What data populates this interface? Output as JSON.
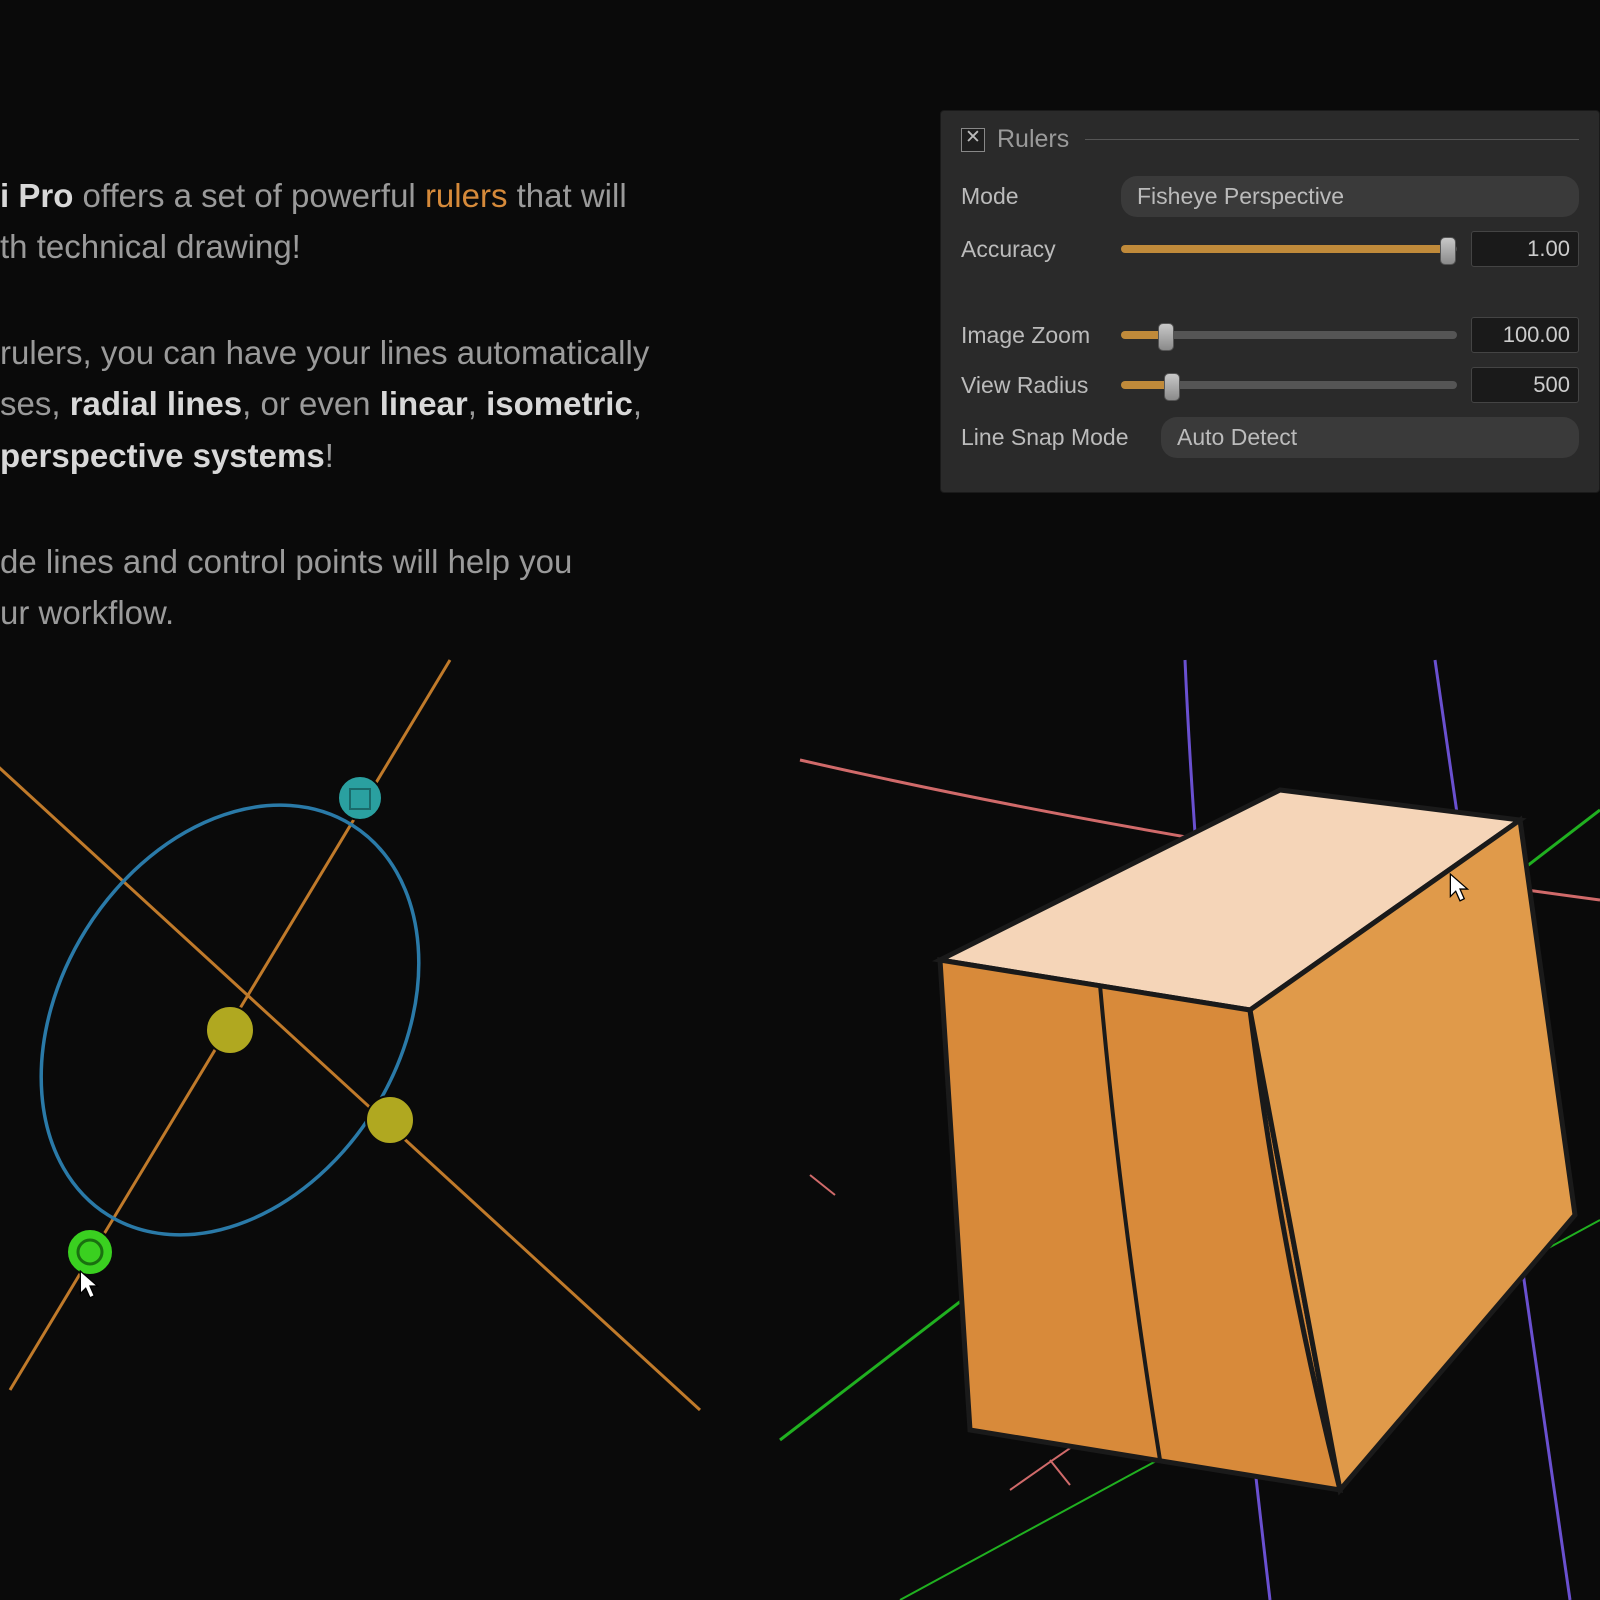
{
  "text": {
    "p1_a": "i Pro",
    "p1_b": " offers a set of powerful ",
    "p1_c": "rulers",
    "p1_d": " that will ",
    "p1_e": "th technical drawing!",
    "p2_a": " rulers, you can have your lines automatically ",
    "p2_b": "ses, ",
    "p2_c": "radial lines",
    "p2_d": ", or even ",
    "p2_e": "linear",
    "p2_f": ", ",
    "p2_g": "isometric",
    "p2_h": ", ",
    "p2_i": " perspective systems",
    "p2_j": "!",
    "p3_a": "de lines and control points will help you ",
    "p3_b": "ur workflow."
  },
  "panel": {
    "title": "Rulers",
    "mode_label": "Mode",
    "mode_value": "Fisheye Perspective",
    "accuracy_label": "Accuracy",
    "accuracy_value": "1.00",
    "zoom_label": "Image Zoom",
    "zoom_value": "100.00",
    "radius_label": "View Radius",
    "radius_value": "500",
    "snap_label": "Line Snap Mode",
    "snap_value": "Auto Detect"
  }
}
